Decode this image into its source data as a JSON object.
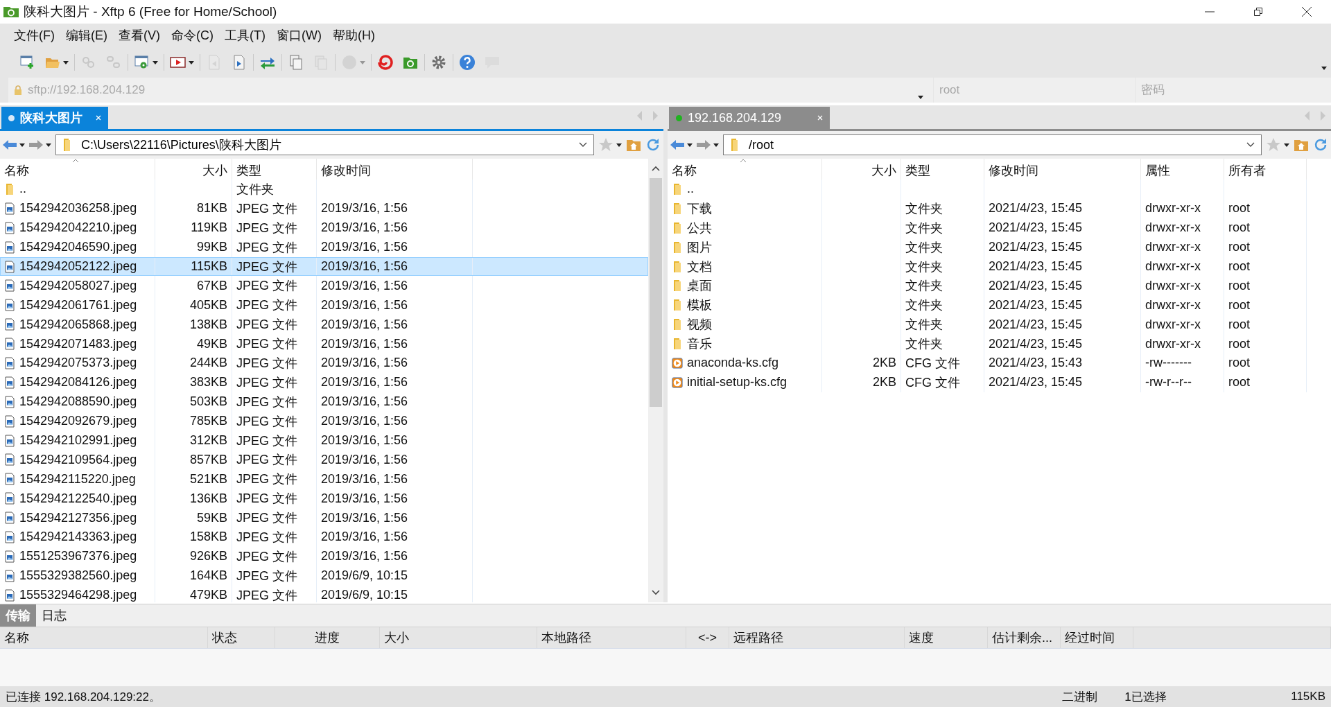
{
  "window": {
    "title": "陕科大图片 - Xftp 6 (Free for Home/School)"
  },
  "menu": [
    "文件(F)",
    "编辑(E)",
    "查看(V)",
    "命令(C)",
    "工具(T)",
    "窗口(W)",
    "帮助(H)"
  ],
  "toolbar": [
    [
      {
        "kind": "new-session",
        "disabled": false,
        "dropdown": false
      },
      {
        "kind": "open-folder",
        "disabled": false,
        "dropdown": true
      }
    ],
    [
      {
        "kind": "link",
        "disabled": true,
        "dropdown": false
      },
      {
        "kind": "unlink",
        "disabled": true,
        "dropdown": false
      }
    ],
    [
      {
        "kind": "window-gear",
        "disabled": false,
        "dropdown": true
      }
    ],
    [
      {
        "kind": "play",
        "disabled": false,
        "dropdown": true
      }
    ],
    [
      {
        "kind": "doc-left",
        "disabled": true,
        "dropdown": false
      },
      {
        "kind": "doc-right",
        "disabled": false,
        "dropdown": false
      }
    ],
    [
      {
        "kind": "swap",
        "disabled": false,
        "dropdown": false
      }
    ],
    [
      {
        "kind": "copy",
        "disabled": false,
        "dropdown": false
      },
      {
        "kind": "paste",
        "disabled": true,
        "dropdown": false
      }
    ],
    [
      {
        "kind": "circle",
        "disabled": true,
        "dropdown": true
      }
    ],
    [
      {
        "kind": "spiral",
        "disabled": false,
        "dropdown": false
      },
      {
        "kind": "green-folder",
        "disabled": false,
        "dropdown": false
      }
    ],
    [
      {
        "kind": "gear",
        "disabled": false,
        "dropdown": false
      }
    ],
    [
      {
        "kind": "help",
        "disabled": false,
        "dropdown": false
      },
      {
        "kind": "chat",
        "disabled": true,
        "dropdown": false
      }
    ]
  ],
  "address_bar": {
    "host_placeholder": "sftp://192.168.204.129",
    "user_placeholder": "root",
    "password_placeholder": "密码"
  },
  "left_panel": {
    "tab": {
      "label": "陕科大图片",
      "selected": true,
      "connected": false
    },
    "path": "C:\\Users\\22116\\Pictures\\陕科大图片",
    "columns": [
      "名称",
      "大小",
      "类型",
      "修改时间"
    ],
    "rows": [
      {
        "kind": "folder",
        "name": "..",
        "size": "",
        "type": "文件夹",
        "modified": "",
        "selected": false
      },
      {
        "kind": "image",
        "name": "1542942036258.jpeg",
        "size": "81KB",
        "type": "JPEG 文件",
        "modified": "2019/3/16, 1:56",
        "selected": false
      },
      {
        "kind": "image",
        "name": "1542942042210.jpeg",
        "size": "119KB",
        "type": "JPEG 文件",
        "modified": "2019/3/16, 1:56",
        "selected": false
      },
      {
        "kind": "image",
        "name": "1542942046590.jpeg",
        "size": "99KB",
        "type": "JPEG 文件",
        "modified": "2019/3/16, 1:56",
        "selected": false
      },
      {
        "kind": "image",
        "name": "1542942052122.jpeg",
        "size": "115KB",
        "type": "JPEG 文件",
        "modified": "2019/3/16, 1:56",
        "selected": true
      },
      {
        "kind": "image",
        "name": "1542942058027.jpeg",
        "size": "67KB",
        "type": "JPEG 文件",
        "modified": "2019/3/16, 1:56",
        "selected": false
      },
      {
        "kind": "image",
        "name": "1542942061761.jpeg",
        "size": "405KB",
        "type": "JPEG 文件",
        "modified": "2019/3/16, 1:56",
        "selected": false
      },
      {
        "kind": "image",
        "name": "1542942065868.jpeg",
        "size": "138KB",
        "type": "JPEG 文件",
        "modified": "2019/3/16, 1:56",
        "selected": false
      },
      {
        "kind": "image",
        "name": "1542942071483.jpeg",
        "size": "49KB",
        "type": "JPEG 文件",
        "modified": "2019/3/16, 1:56",
        "selected": false
      },
      {
        "kind": "image",
        "name": "1542942075373.jpeg",
        "size": "244KB",
        "type": "JPEG 文件",
        "modified": "2019/3/16, 1:56",
        "selected": false
      },
      {
        "kind": "image",
        "name": "1542942084126.jpeg",
        "size": "383KB",
        "type": "JPEG 文件",
        "modified": "2019/3/16, 1:56",
        "selected": false
      },
      {
        "kind": "image",
        "name": "1542942088590.jpeg",
        "size": "503KB",
        "type": "JPEG 文件",
        "modified": "2019/3/16, 1:56",
        "selected": false
      },
      {
        "kind": "image",
        "name": "1542942092679.jpeg",
        "size": "785KB",
        "type": "JPEG 文件",
        "modified": "2019/3/16, 1:56",
        "selected": false
      },
      {
        "kind": "image",
        "name": "1542942102991.jpeg",
        "size": "312KB",
        "type": "JPEG 文件",
        "modified": "2019/3/16, 1:56",
        "selected": false
      },
      {
        "kind": "image",
        "name": "1542942109564.jpeg",
        "size": "857KB",
        "type": "JPEG 文件",
        "modified": "2019/3/16, 1:56",
        "selected": false
      },
      {
        "kind": "image",
        "name": "1542942115220.jpeg",
        "size": "521KB",
        "type": "JPEG 文件",
        "modified": "2019/3/16, 1:56",
        "selected": false
      },
      {
        "kind": "image",
        "name": "1542942122540.jpeg",
        "size": "136KB",
        "type": "JPEG 文件",
        "modified": "2019/3/16, 1:56",
        "selected": false
      },
      {
        "kind": "image",
        "name": "1542942127356.jpeg",
        "size": "59KB",
        "type": "JPEG 文件",
        "modified": "2019/3/16, 1:56",
        "selected": false
      },
      {
        "kind": "image",
        "name": "1542942143363.jpeg",
        "size": "158KB",
        "type": "JPEG 文件",
        "modified": "2019/3/16, 1:56",
        "selected": false
      },
      {
        "kind": "image",
        "name": "1551253967376.jpeg",
        "size": "926KB",
        "type": "JPEG 文件",
        "modified": "2019/3/16, 1:56",
        "selected": false
      },
      {
        "kind": "image",
        "name": "1555329382560.jpeg",
        "size": "164KB",
        "type": "JPEG 文件",
        "modified": "2019/6/9, 10:15",
        "selected": false
      },
      {
        "kind": "image",
        "name": "1555329464298.jpeg",
        "size": "479KB",
        "type": "JPEG 文件",
        "modified": "2019/6/9, 10:15",
        "selected": false
      }
    ]
  },
  "right_panel": {
    "tab": {
      "label": "192.168.204.129",
      "selected": false,
      "connected": true
    },
    "path": "/root",
    "columns": [
      "名称",
      "大小",
      "类型",
      "修改时间",
      "属性",
      "所有者"
    ],
    "rows": [
      {
        "kind": "folder",
        "name": "..",
        "size": "",
        "type": "",
        "modified": "",
        "attributes": "",
        "owner": "",
        "selected": false
      },
      {
        "kind": "folder",
        "name": "下载",
        "size": "",
        "type": "文件夹",
        "modified": "2021/4/23, 15:45",
        "attributes": "drwxr-xr-x",
        "owner": "root",
        "selected": false
      },
      {
        "kind": "folder",
        "name": "公共",
        "size": "",
        "type": "文件夹",
        "modified": "2021/4/23, 15:45",
        "attributes": "drwxr-xr-x",
        "owner": "root",
        "selected": false
      },
      {
        "kind": "folder",
        "name": "图片",
        "size": "",
        "type": "文件夹",
        "modified": "2021/4/23, 15:45",
        "attributes": "drwxr-xr-x",
        "owner": "root",
        "selected": false
      },
      {
        "kind": "folder",
        "name": "文档",
        "size": "",
        "type": "文件夹",
        "modified": "2021/4/23, 15:45",
        "attributes": "drwxr-xr-x",
        "owner": "root",
        "selected": false
      },
      {
        "kind": "folder",
        "name": "桌面",
        "size": "",
        "type": "文件夹",
        "modified": "2021/4/23, 15:45",
        "attributes": "drwxr-xr-x",
        "owner": "root",
        "selected": false
      },
      {
        "kind": "folder",
        "name": "模板",
        "size": "",
        "type": "文件夹",
        "modified": "2021/4/23, 15:45",
        "attributes": "drwxr-xr-x",
        "owner": "root",
        "selected": false
      },
      {
        "kind": "folder",
        "name": "视频",
        "size": "",
        "type": "文件夹",
        "modified": "2021/4/23, 15:45",
        "attributes": "drwxr-xr-x",
        "owner": "root",
        "selected": false
      },
      {
        "kind": "folder",
        "name": "音乐",
        "size": "",
        "type": "文件夹",
        "modified": "2021/4/23, 15:45",
        "attributes": "drwxr-xr-x",
        "owner": "root",
        "selected": false
      },
      {
        "kind": "config",
        "name": "anaconda-ks.cfg",
        "size": "2KB",
        "type": "CFG 文件",
        "modified": "2021/4/23, 15:43",
        "attributes": "-rw-------",
        "owner": "root",
        "selected": false
      },
      {
        "kind": "config",
        "name": "initial-setup-ks.cfg",
        "size": "2KB",
        "type": "CFG 文件",
        "modified": "2021/4/23, 15:45",
        "attributes": "-rw-r--r--",
        "owner": "root",
        "selected": false
      }
    ]
  },
  "bottom_tabs": [
    {
      "label": "传输",
      "selected": true
    },
    {
      "label": "日志",
      "selected": false
    }
  ],
  "transfer_columns": [
    "名称",
    "状态",
    "进度",
    "大小",
    "本地路径",
    "<->",
    "远程路径",
    "速度",
    "估计剩余...",
    "经过时间"
  ],
  "status_bar": {
    "message": "已连接 192.168.204.129:22。",
    "mode": "二进制",
    "selection": "1已选择",
    "size": "115KB"
  }
}
